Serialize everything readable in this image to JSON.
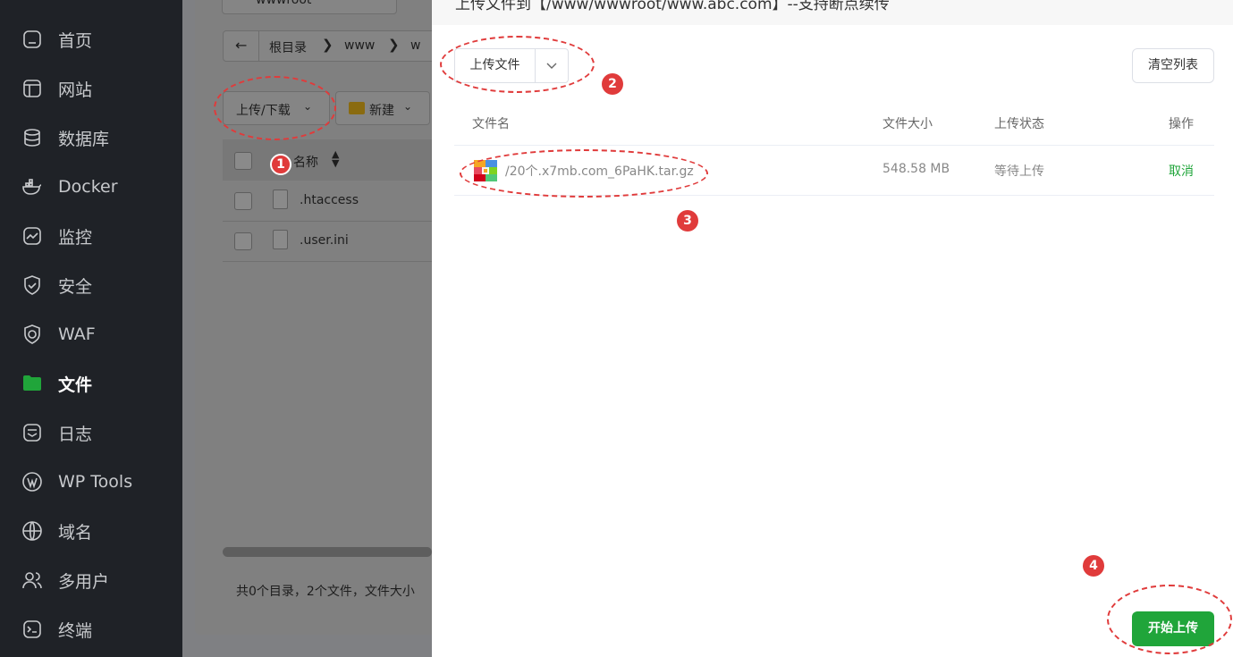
{
  "sidebar": {
    "items": [
      {
        "label": "首页",
        "icon": "home-icon"
      },
      {
        "label": "网站",
        "icon": "website-icon"
      },
      {
        "label": "数据库",
        "icon": "database-icon"
      },
      {
        "label": "Docker",
        "icon": "docker-icon"
      },
      {
        "label": "监控",
        "icon": "monitor-icon"
      },
      {
        "label": "安全",
        "icon": "shield-icon"
      },
      {
        "label": "WAF",
        "icon": "waf-icon"
      },
      {
        "label": "文件",
        "icon": "folder-icon",
        "active": true
      },
      {
        "label": "日志",
        "icon": "log-icon"
      },
      {
        "label": "WP Tools",
        "icon": "wordpress-icon"
      },
      {
        "label": "域名",
        "icon": "globe-icon"
      },
      {
        "label": "多用户",
        "icon": "users-icon"
      },
      {
        "label": "终端",
        "icon": "terminal-icon"
      }
    ]
  },
  "files": {
    "tab_partial": "wwwroot",
    "breadcrumb": [
      "根目录",
      "www",
      "w"
    ],
    "upload_download": "上传/下载",
    "new_label": "新建",
    "name_header": "名称",
    "rows": [
      ".htaccess",
      ".user.ini"
    ],
    "footer": "共0个目录，2个文件，文件大小"
  },
  "dialog": {
    "title": "上传文件到【/www/wwwroot/www.abc.com】--支持断点续传",
    "upload_button": "上传文件",
    "clear_button": "清空列表",
    "columns": {
      "name": "文件名",
      "size": "文件大小",
      "status": "上传状态",
      "action": "操作"
    },
    "file": {
      "name": "/20个.x7mb.com_6PaHK.tar.gz",
      "size": "548.58 MB",
      "status": "等待上传",
      "action": "取消"
    },
    "start_button": "开始上传"
  },
  "annotations": [
    "1",
    "2",
    "3",
    "4"
  ],
  "colors": {
    "accent": "#20a53a",
    "annotation": "#e03b3b",
    "sidebar": "#1f2227"
  }
}
